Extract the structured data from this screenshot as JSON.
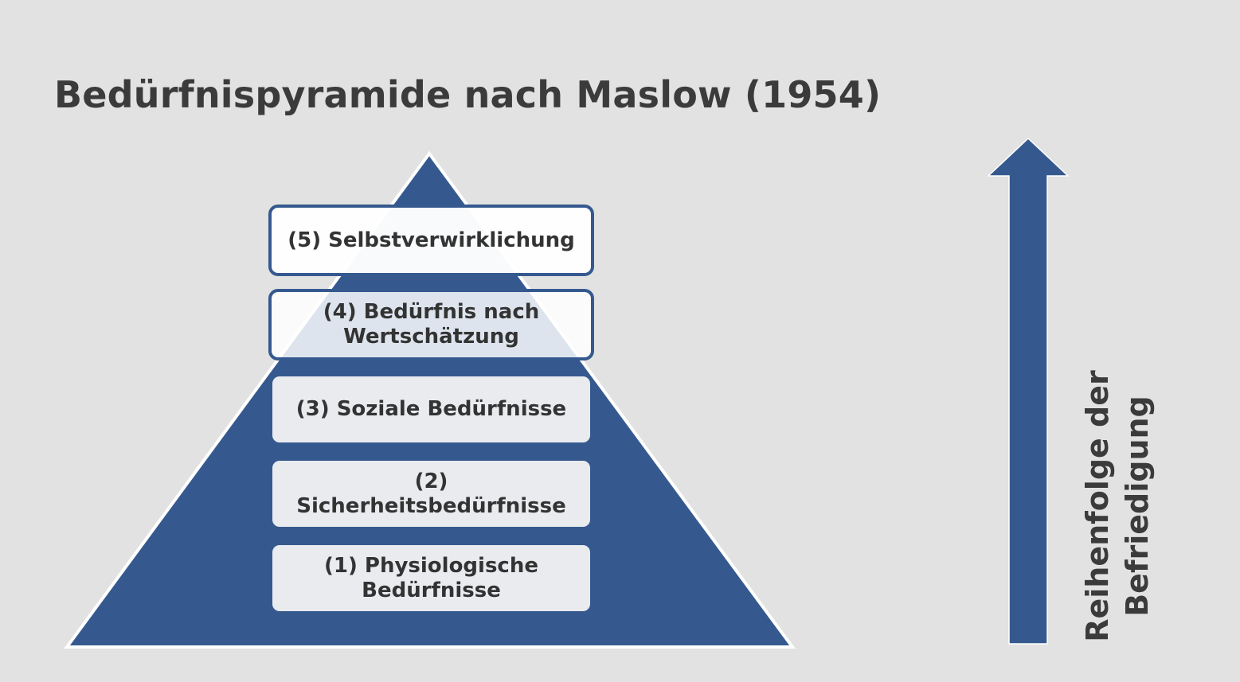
{
  "title": "Bedürfnispyramide nach Maslow (1954)",
  "pyramid": {
    "color": "#35598f",
    "levels": [
      {
        "label": "(5) Selbstverwirklichung"
      },
      {
        "label_line1": "(4) Bedürfnis nach",
        "label_line2": "Wertschätzung"
      },
      {
        "label": "(3) Soziale Bedürfnisse"
      },
      {
        "label": "(2) Sicherheitsbedürfnisse"
      },
      {
        "label_line1": "(1) Physiologische",
        "label_line2": "Bedürfnisse"
      }
    ]
  },
  "arrow": {
    "color": "#35598f",
    "direction": "up",
    "label_line1": "Reihenfolge der",
    "label_line2": "Befriedigung"
  }
}
